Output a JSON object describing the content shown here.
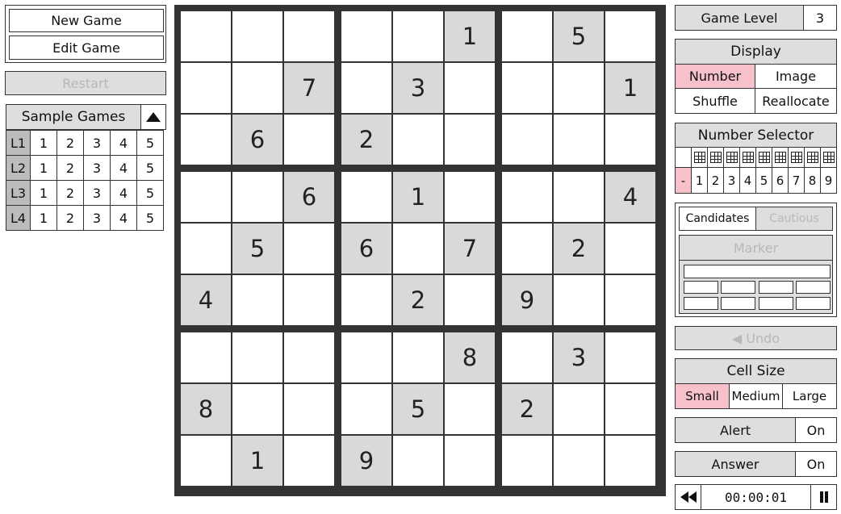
{
  "left": {
    "new_game": "New Game",
    "edit_game": "Edit Game",
    "restart": "Restart",
    "sample_games": "Sample Games",
    "sample_toggle_icon": "triangle-up-icon",
    "levels": [
      {
        "label": "L1",
        "games": [
          "1",
          "2",
          "3",
          "4",
          "5"
        ]
      },
      {
        "label": "L2",
        "games": [
          "1",
          "2",
          "3",
          "4",
          "5"
        ]
      },
      {
        "label": "L3",
        "games": [
          "1",
          "2",
          "3",
          "4",
          "5"
        ],
        "selected_index": 3
      },
      {
        "label": "L4",
        "games": [
          "1",
          "2",
          "3",
          "4",
          "5"
        ]
      }
    ]
  },
  "board": {
    "rows": [
      [
        "",
        "",
        "",
        "",
        "",
        "1",
        "",
        "5",
        ""
      ],
      [
        "",
        "",
        "7",
        "",
        "3",
        "",
        "",
        "",
        "1"
      ],
      [
        "",
        "6",
        "",
        "2",
        "",
        "",
        "",
        "",
        ""
      ],
      [
        "",
        "",
        "6",
        "",
        "1",
        "",
        "",
        "",
        "4"
      ],
      [
        "",
        "5",
        "",
        "6",
        "",
        "7",
        "",
        "2",
        ""
      ],
      [
        "4",
        "",
        "",
        "",
        "2",
        "",
        "9",
        "",
        ""
      ],
      [
        "",
        "",
        "",
        "",
        "",
        "8",
        "",
        "3",
        ""
      ],
      [
        "8",
        "",
        "",
        "",
        "5",
        "",
        "2",
        "",
        ""
      ],
      [
        "",
        "1",
        "",
        "9",
        "",
        "",
        "",
        "",
        ""
      ]
    ]
  },
  "right": {
    "game_level_label": "Game Level",
    "game_level_value": "3",
    "display": {
      "title": "Display",
      "options": [
        "Number",
        "Image",
        "Shuffle",
        "Reallocate"
      ],
      "selected": "Number"
    },
    "number_selector": {
      "title": "Number Selector",
      "clear_label": "-",
      "numbers": [
        "1",
        "2",
        "3",
        "4",
        "5",
        "6",
        "7",
        "8",
        "9"
      ]
    },
    "candidates": {
      "candidates_label": "Candidates",
      "cautious_label": "Cautious",
      "marker_label": "Marker"
    },
    "undo_label": "◀ Undo",
    "cell_size": {
      "title": "Cell Size",
      "options": [
        "Small",
        "Medium",
        "Large"
      ],
      "selected": "Small"
    },
    "alert_label": "Alert",
    "alert_value": "On",
    "answer_label": "Answer",
    "answer_value": "On",
    "timer": "00:00:01",
    "rewind_icon": "rewind-icon",
    "pause_icon": "pause-icon"
  },
  "colors": {
    "selected": "#f7c1cc",
    "given_cell": "#d9d9d9",
    "board_border": "#333333",
    "button_gray": "#dedede"
  }
}
